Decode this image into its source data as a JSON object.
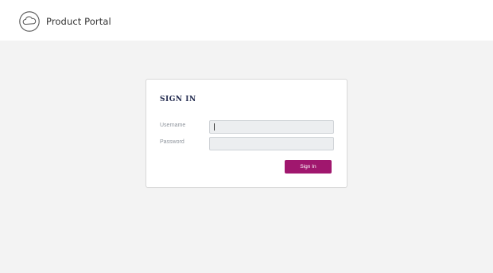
{
  "header": {
    "title": "Product Portal",
    "logo_icon": "cloud-icon"
  },
  "signin": {
    "title": "SIGN IN",
    "username_label": "Username",
    "username_value": "",
    "password_label": "Password",
    "password_value": "",
    "button_label": "Sign In"
  },
  "colors": {
    "accent": "#a0176e",
    "title": "#232b4f",
    "background": "#f3f3f3"
  }
}
